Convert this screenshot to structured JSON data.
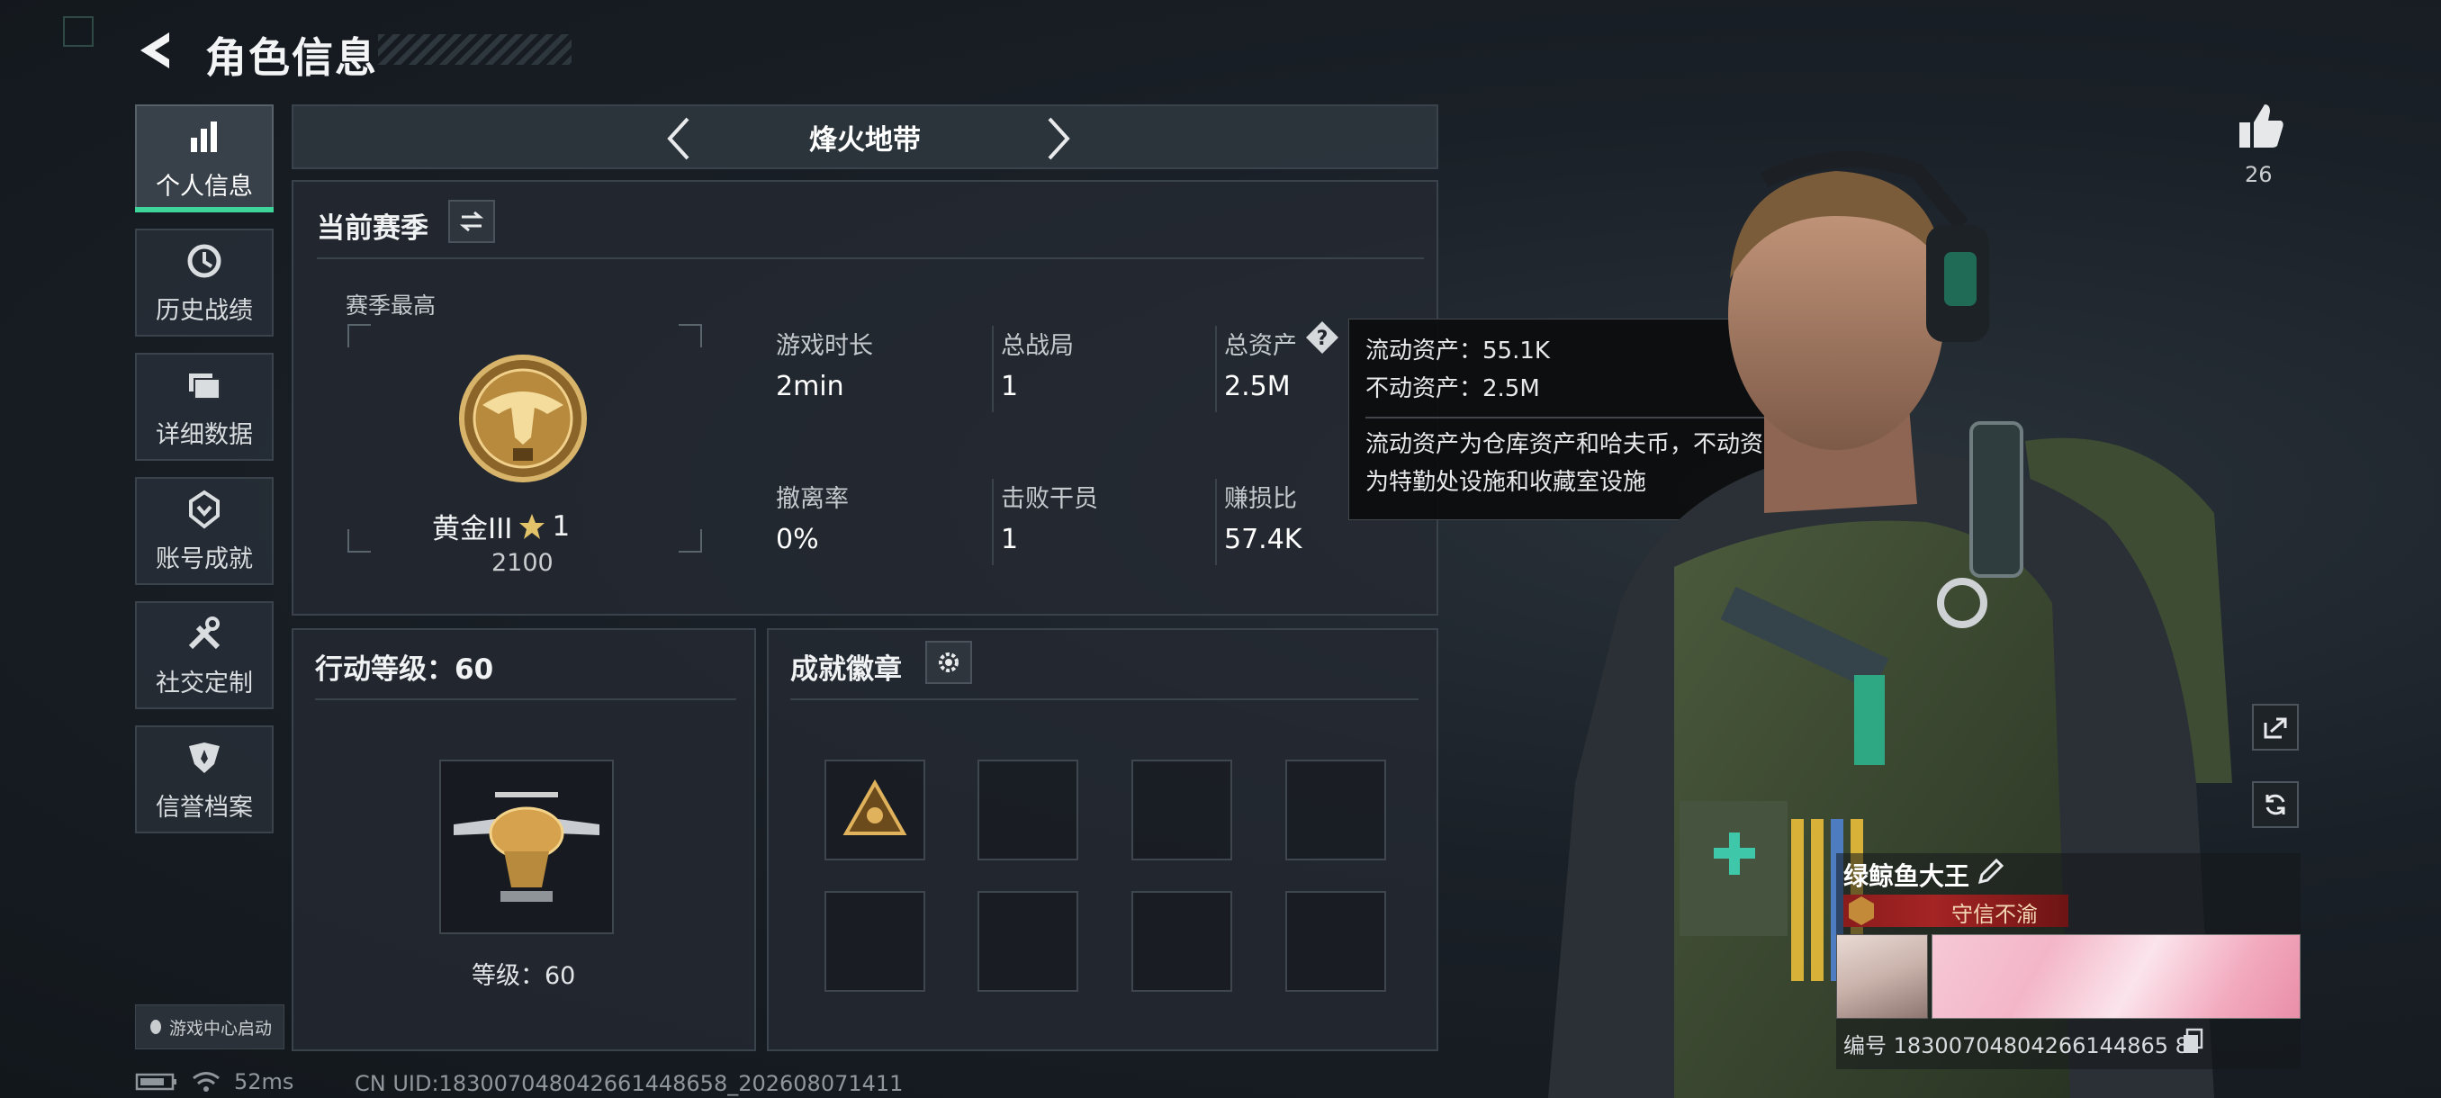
{
  "header": {
    "title": "角色信息"
  },
  "sidebar": {
    "items": [
      {
        "label": "个人信息",
        "icon": "bar-chart-icon",
        "active": true
      },
      {
        "label": "历史战绩",
        "icon": "history-clock-icon"
      },
      {
        "label": "详细数据",
        "icon": "folder-stack-icon"
      },
      {
        "label": "账号成就",
        "icon": "achievement-emblem-icon"
      },
      {
        "label": "社交定制",
        "icon": "wrench-tools-icon"
      },
      {
        "label": "信誉档案",
        "icon": "shield-star-icon"
      }
    ],
    "launch_label": "游戏中心启动"
  },
  "mode_bar": {
    "title": "烽火地带"
  },
  "season": {
    "title": "当前赛季",
    "best_label": "赛季最高",
    "rank_name": "黄金III",
    "rank_stars": "1",
    "rank_score": "2100",
    "stats": [
      {
        "label": "游戏时长",
        "value": "2min"
      },
      {
        "label": "总战局",
        "value": "1"
      },
      {
        "label": "总资产",
        "value": "2.5M"
      },
      {
        "label": "撤离率",
        "value": "0%"
      },
      {
        "label": "击败干员",
        "value": "1"
      },
      {
        "label": "赚损比",
        "value": "57.4K"
      }
    ]
  },
  "tooltip": {
    "liquid": "流动资产：55.1K",
    "fixed": "不动资产：2.5M",
    "desc_line1": "流动资产为仓库资产和哈夫币，不动资产",
    "desc_line2": "为特勤处设施和收藏室设施"
  },
  "level": {
    "title": "行动等级：60",
    "label": "等级：60"
  },
  "badges": {
    "title": "成就徽章"
  },
  "likes": {
    "count": "26"
  },
  "player": {
    "name": "绿鲸鱼大王",
    "title": "守信不渝",
    "id_text": "编号 18300704804266144865 8"
  },
  "status": {
    "ping": "52ms",
    "uid": "CN UID:183007048042661448658_202608071411"
  },
  "colors": {
    "accent": "#3ed59a",
    "tooltip_bg": "#0c0d0e",
    "title_band": "#a52424"
  }
}
